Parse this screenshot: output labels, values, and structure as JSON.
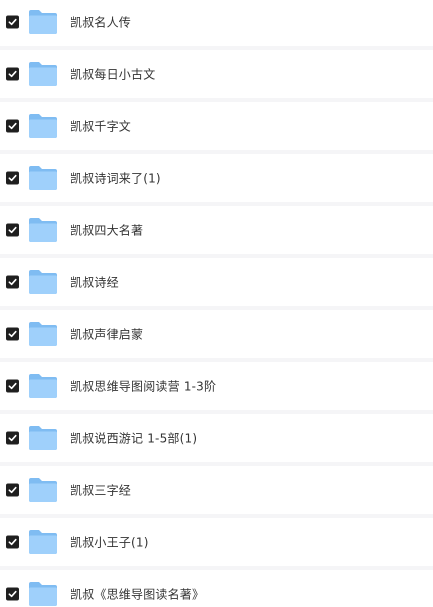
{
  "colors": {
    "checkbox": "#1f1f1f",
    "folder_back": "#7fbcf2",
    "folder_front": "#9fd0fb",
    "row_bg": "#ffffff",
    "gap_bg": "#f5f5f7",
    "text": "#333333"
  },
  "icons": {
    "checkbox": "checked-checkbox-icon",
    "folder": "folder-icon"
  },
  "files": [
    {
      "name": "凯叔名人传",
      "checked": true
    },
    {
      "name": "凯叔每日小古文",
      "checked": true
    },
    {
      "name": "凯叔千字文",
      "checked": true
    },
    {
      "name": "凯叔诗词来了(1)",
      "checked": true
    },
    {
      "name": "凯叔四大名著",
      "checked": true
    },
    {
      "name": "凯叔诗经",
      "checked": true
    },
    {
      "name": "凯叔声律启蒙",
      "checked": true
    },
    {
      "name": "凯叔思维导图阅读营 1-3阶",
      "checked": true
    },
    {
      "name": "凯叔说西游记 1-5部(1)",
      "checked": true
    },
    {
      "name": "凯叔三字经",
      "checked": true
    },
    {
      "name": "凯叔小王子(1)",
      "checked": true
    },
    {
      "name": "凯叔《思维导图读名著》",
      "checked": true
    }
  ]
}
